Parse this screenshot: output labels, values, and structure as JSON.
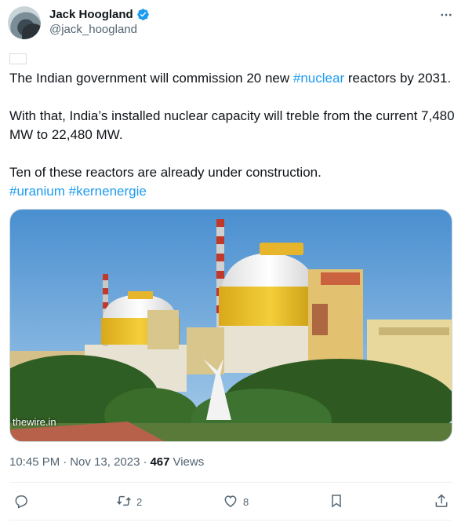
{
  "author": {
    "display_name": "Jack Hoogland",
    "handle": "@jack_hoogland",
    "verified": true
  },
  "tweet": {
    "line1_text": " The Indian government will commission 20 new ",
    "line1_hashtag": "#nuclear",
    "line1_tail": " reactors by 2031.",
    "para2": "With that, India’s installed nuclear capacity will treble from the current 7,480 MW to 22,480 MW.",
    "para3": "Ten of these reactors are already under construction.",
    "hashtags": [
      "#uranium",
      "#kernenergie"
    ]
  },
  "media": {
    "credit": "thewire.in"
  },
  "meta": {
    "time": "10:45 PM",
    "date": "Nov 13, 2023",
    "views_count": "467",
    "views_label": "Views"
  },
  "actions": {
    "reply_count": "",
    "retweet_count": "2",
    "like_count": "8"
  },
  "icons": {
    "verified": "verified-badge-icon",
    "more": "more-dots-icon",
    "reply": "reply-icon",
    "retweet": "retweet-icon",
    "like": "heart-icon",
    "bookmark": "bookmark-icon",
    "share": "share-icon"
  },
  "colors": {
    "link": "#1d9bf0",
    "secondary_text": "#536471",
    "primary_text": "#0f1419"
  }
}
